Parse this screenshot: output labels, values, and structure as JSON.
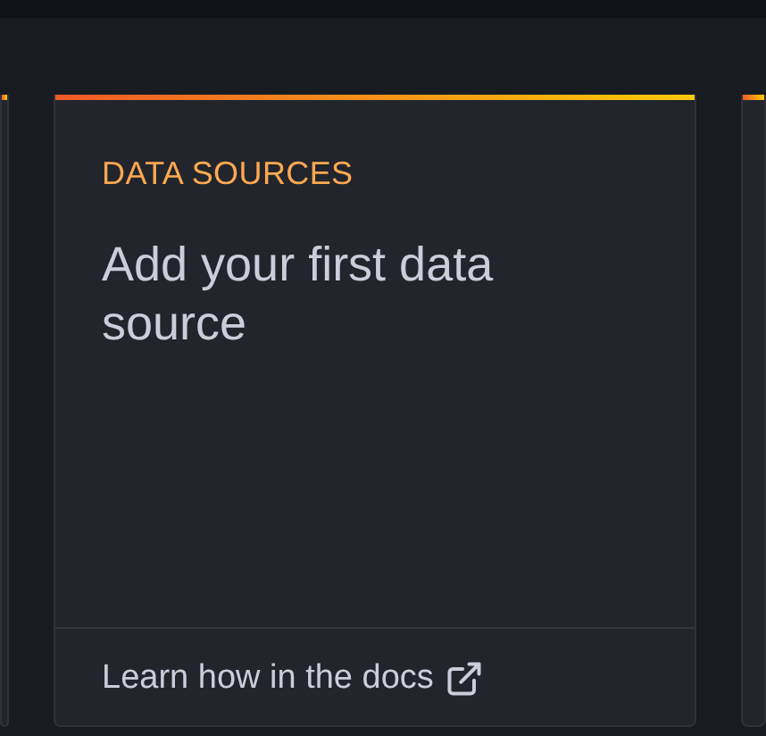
{
  "card": {
    "title": "DATA SOURCES",
    "heading": "Add your first data source",
    "link": "Learn how in the docs"
  }
}
